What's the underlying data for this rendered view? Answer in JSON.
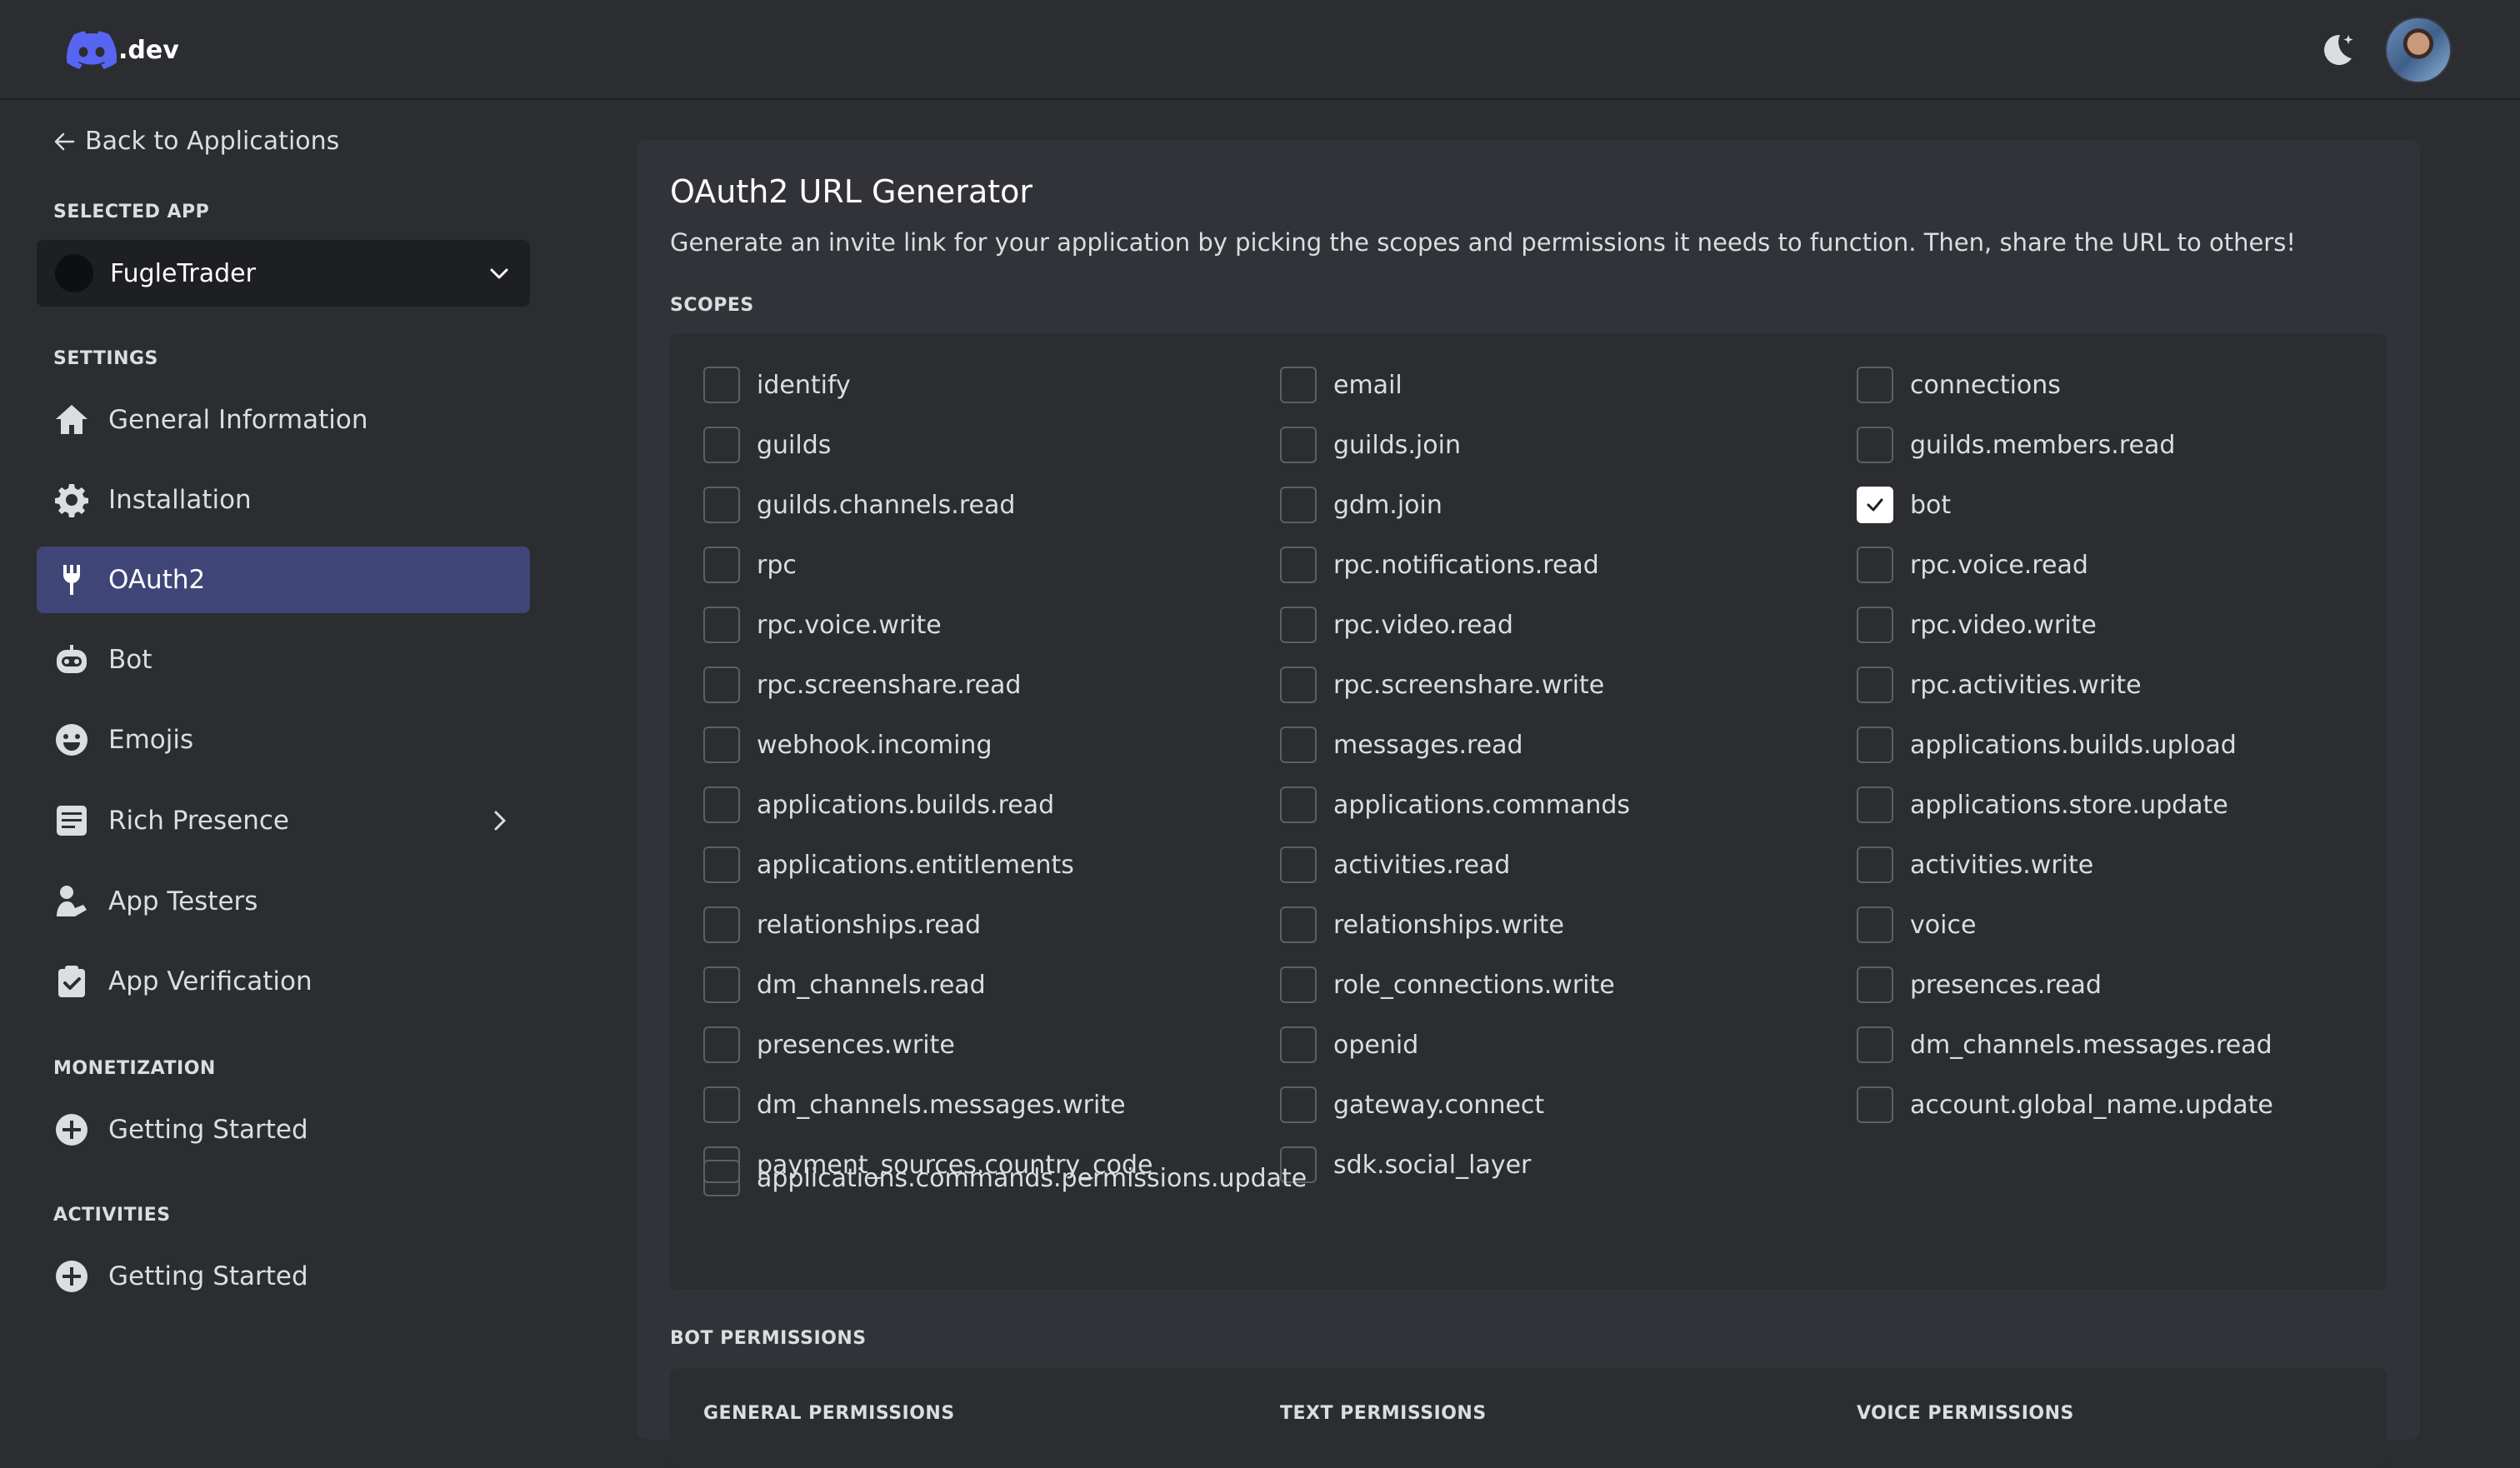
{
  "header": {
    "logo_text": ".dev",
    "brand_color": "#5865f2"
  },
  "sidebar": {
    "back_label": "Back to Applications",
    "selected_app_heading": "SELECTED APP",
    "selected_app_name": "FugleTrader",
    "settings_heading": "SETTINGS",
    "settings_items": [
      {
        "label": "General Information",
        "icon": "home-icon"
      },
      {
        "label": "Installation",
        "icon": "gear-icon"
      },
      {
        "label": "OAuth2",
        "icon": "wrench-icon",
        "active": true
      },
      {
        "label": "Bot",
        "icon": "robot-icon"
      },
      {
        "label": "Emojis",
        "icon": "smiley-icon"
      },
      {
        "label": "Rich Presence",
        "icon": "document-icon"
      },
      {
        "label": "App Testers",
        "icon": "user-icon"
      },
      {
        "label": "App Verification",
        "icon": "clipboard-check-icon"
      }
    ],
    "monetization_heading": "MONETIZATION",
    "monetization_items": [
      {
        "label": "Getting Started",
        "icon": "plus-circle-icon"
      }
    ],
    "activities_heading": "ACTIVITIES",
    "activities_items": [
      {
        "label": "Getting Started",
        "icon": "plus-circle-icon"
      }
    ]
  },
  "main": {
    "title": "OAuth2 URL Generator",
    "description": "Generate an invite link for your application by picking the scopes and permissions it needs to function. Then, share the URL to others!",
    "scopes_heading": "SCOPES",
    "scopes": [
      {
        "label": "identify",
        "checked": false
      },
      {
        "label": "email",
        "checked": false
      },
      {
        "label": "connections",
        "checked": false
      },
      {
        "label": "guilds",
        "checked": false
      },
      {
        "label": "guilds.join",
        "checked": false
      },
      {
        "label": "guilds.members.read",
        "checked": false
      },
      {
        "label": "guilds.channels.read",
        "checked": false
      },
      {
        "label": "gdm.join",
        "checked": false
      },
      {
        "label": "bot",
        "checked": true
      },
      {
        "label": "rpc",
        "checked": false
      },
      {
        "label": "rpc.notifications.read",
        "checked": false
      },
      {
        "label": "rpc.voice.read",
        "checked": false
      },
      {
        "label": "rpc.voice.write",
        "checked": false
      },
      {
        "label": "rpc.video.read",
        "checked": false
      },
      {
        "label": "rpc.video.write",
        "checked": false
      },
      {
        "label": "rpc.screenshare.read",
        "checked": false
      },
      {
        "label": "rpc.screenshare.write",
        "checked": false
      },
      {
        "label": "rpc.activities.write",
        "checked": false
      },
      {
        "label": "webhook.incoming",
        "checked": false
      },
      {
        "label": "messages.read",
        "checked": false
      },
      {
        "label": "applications.builds.upload",
        "checked": false
      },
      {
        "label": "applications.builds.read",
        "checked": false
      },
      {
        "label": "applications.commands",
        "checked": false
      },
      {
        "label": "applications.store.update",
        "checked": false
      },
      {
        "label": "applications.entitlements",
        "checked": false
      },
      {
        "label": "activities.read",
        "checked": false
      },
      {
        "label": "activities.write",
        "checked": false
      },
      {
        "label": "relationships.read",
        "checked": false
      },
      {
        "label": "relationships.write",
        "checked": false
      },
      {
        "label": "voice",
        "checked": false
      },
      {
        "label": "dm_channels.read",
        "checked": false
      },
      {
        "label": "role_connections.write",
        "checked": false
      },
      {
        "label": "presences.read",
        "checked": false
      },
      {
        "label": "presences.write",
        "checked": false
      },
      {
        "label": "openid",
        "checked": false
      },
      {
        "label": "dm_channels.messages.read",
        "checked": false
      },
      {
        "label": "dm_channels.messages.write",
        "checked": false
      },
      {
        "label": "gateway.connect",
        "checked": false
      },
      {
        "label": "account.global_name.update",
        "checked": false
      },
      {
        "label": "payment_sources.country_code",
        "checked": false
      },
      {
        "label": "sdk.social_layer",
        "checked": false
      },
      {
        "label": "applications.commands.permissions.update",
        "checked": false
      }
    ],
    "bot_permissions_heading": "BOT PERMISSIONS",
    "permission_groups": [
      "GENERAL PERMISSIONS",
      "TEXT PERMISSIONS",
      "VOICE PERMISSIONS"
    ]
  }
}
